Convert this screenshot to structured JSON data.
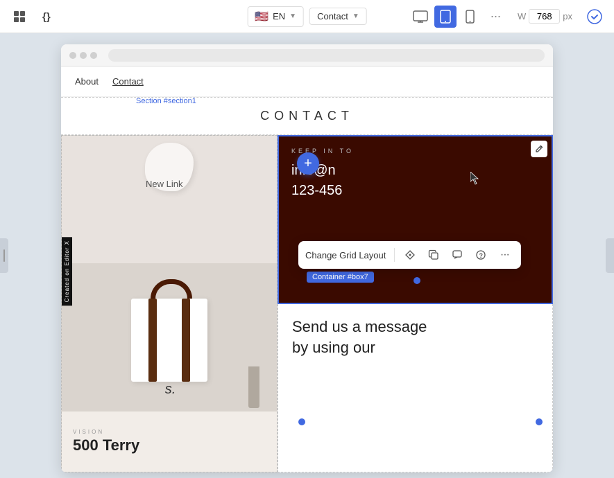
{
  "toolbar": {
    "lang": "EN",
    "page": "Contact",
    "width_label": "W",
    "width_value": "768",
    "width_unit": "px",
    "more_icon": "⋯"
  },
  "devices": [
    {
      "id": "desktop",
      "icon": "🖥",
      "active": false
    },
    {
      "id": "tablet",
      "icon": "⬜",
      "active": true
    },
    {
      "id": "mobile",
      "icon": "📱",
      "active": false
    }
  ],
  "section_label": "Section #section1",
  "nav": {
    "links": [
      "About",
      "Contact"
    ],
    "new_link": "New Link"
  },
  "contact_heading": "CONTACT",
  "left_col": {
    "vision_label": "VISION",
    "vision_number": "500 Terry"
  },
  "right_col": {
    "keep_in_touch": "KEEP IN TO",
    "email": "info@n",
    "phone": "123-456",
    "send_heading": "Send us a message\nby using our"
  },
  "toolbar_popup": {
    "label": "Change Grid Layout",
    "icons": [
      "diamond",
      "copy",
      "comment",
      "question",
      "more"
    ]
  },
  "container_chip": "Container #box7",
  "add_button": "+",
  "editor_badge": "Created on Editor X"
}
